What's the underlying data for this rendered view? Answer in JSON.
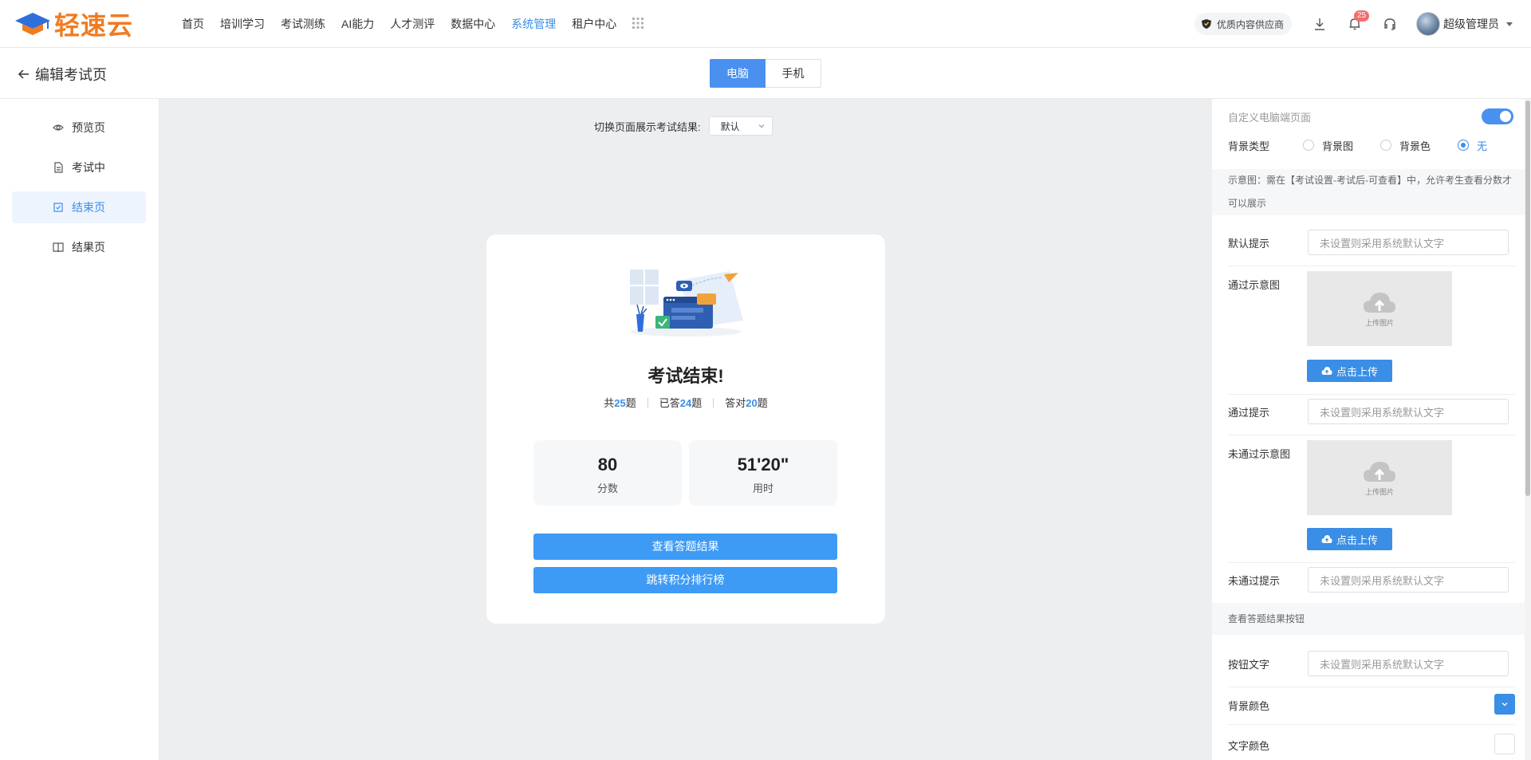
{
  "topbar": {
    "logo_text": "轻速云",
    "nav": [
      {
        "label": "首页"
      },
      {
        "label": "培训学习"
      },
      {
        "label": "考试测练"
      },
      {
        "label": "AI能力"
      },
      {
        "label": "人才测评"
      },
      {
        "label": "数据中心"
      },
      {
        "label": "系统管理",
        "active": true
      },
      {
        "label": "租户中心"
      }
    ],
    "supplier_badge": "优质内容供应商",
    "notification_count": "25",
    "user_name": "超级管理员"
  },
  "page_header": {
    "title": "编辑考试页",
    "device_tabs": [
      "电脑",
      "手机"
    ],
    "active_device": "电脑"
  },
  "sidebar": {
    "items": [
      {
        "label": "预览页",
        "icon": "eye-icon"
      },
      {
        "label": "考试中",
        "icon": "document-icon"
      },
      {
        "label": "结束页",
        "icon": "checkbox-icon",
        "active": true
      },
      {
        "label": "结果页",
        "icon": "book-icon"
      }
    ]
  },
  "canvas": {
    "switch_label": "切换页面展示考试结果:",
    "switch_value": "默认",
    "card": {
      "title": "考试结束!",
      "stats": [
        {
          "prefix": "共",
          "value": "25",
          "suffix": "题"
        },
        {
          "prefix": "已答",
          "value": "24",
          "suffix": "题"
        },
        {
          "prefix": "答对",
          "value": "20",
          "suffix": "题"
        }
      ],
      "score_value": "80",
      "score_label": "分数",
      "time_value": "51'20\"",
      "time_label": "用时",
      "btn_view_results": "查看答题结果",
      "btn_leaderboard": "跳转积分排行榜"
    }
  },
  "panel": {
    "custom_pc_label": "自定义电脑端页面",
    "custom_pc_enabled": true,
    "bg_type_label": "背景类型",
    "bg_options": [
      "背景图",
      "背景色",
      "无"
    ],
    "bg_selected": "无",
    "note": "示意图：需在【考试设置-考试后-可查看】中，允许考生查看分数才可以展示",
    "default_tip_label": "默认提示",
    "input_placeholder": "未设置则采用系统默认文字",
    "pass_image_label": "通过示意图",
    "upload_image_text": "上传图片",
    "upload_btn": "点击上传",
    "pass_tip_label": "通过提示",
    "fail_image_label": "未通过示意图",
    "fail_tip_label": "未通过提示",
    "section_view_btn": "查看答题结果按钮",
    "btn_text_label": "按钮文字",
    "bg_color_label": "背景颜色",
    "bg_color_value": "#3a8ee6",
    "text_color_label": "文字颜色",
    "text_color_value": "#ffffff"
  }
}
